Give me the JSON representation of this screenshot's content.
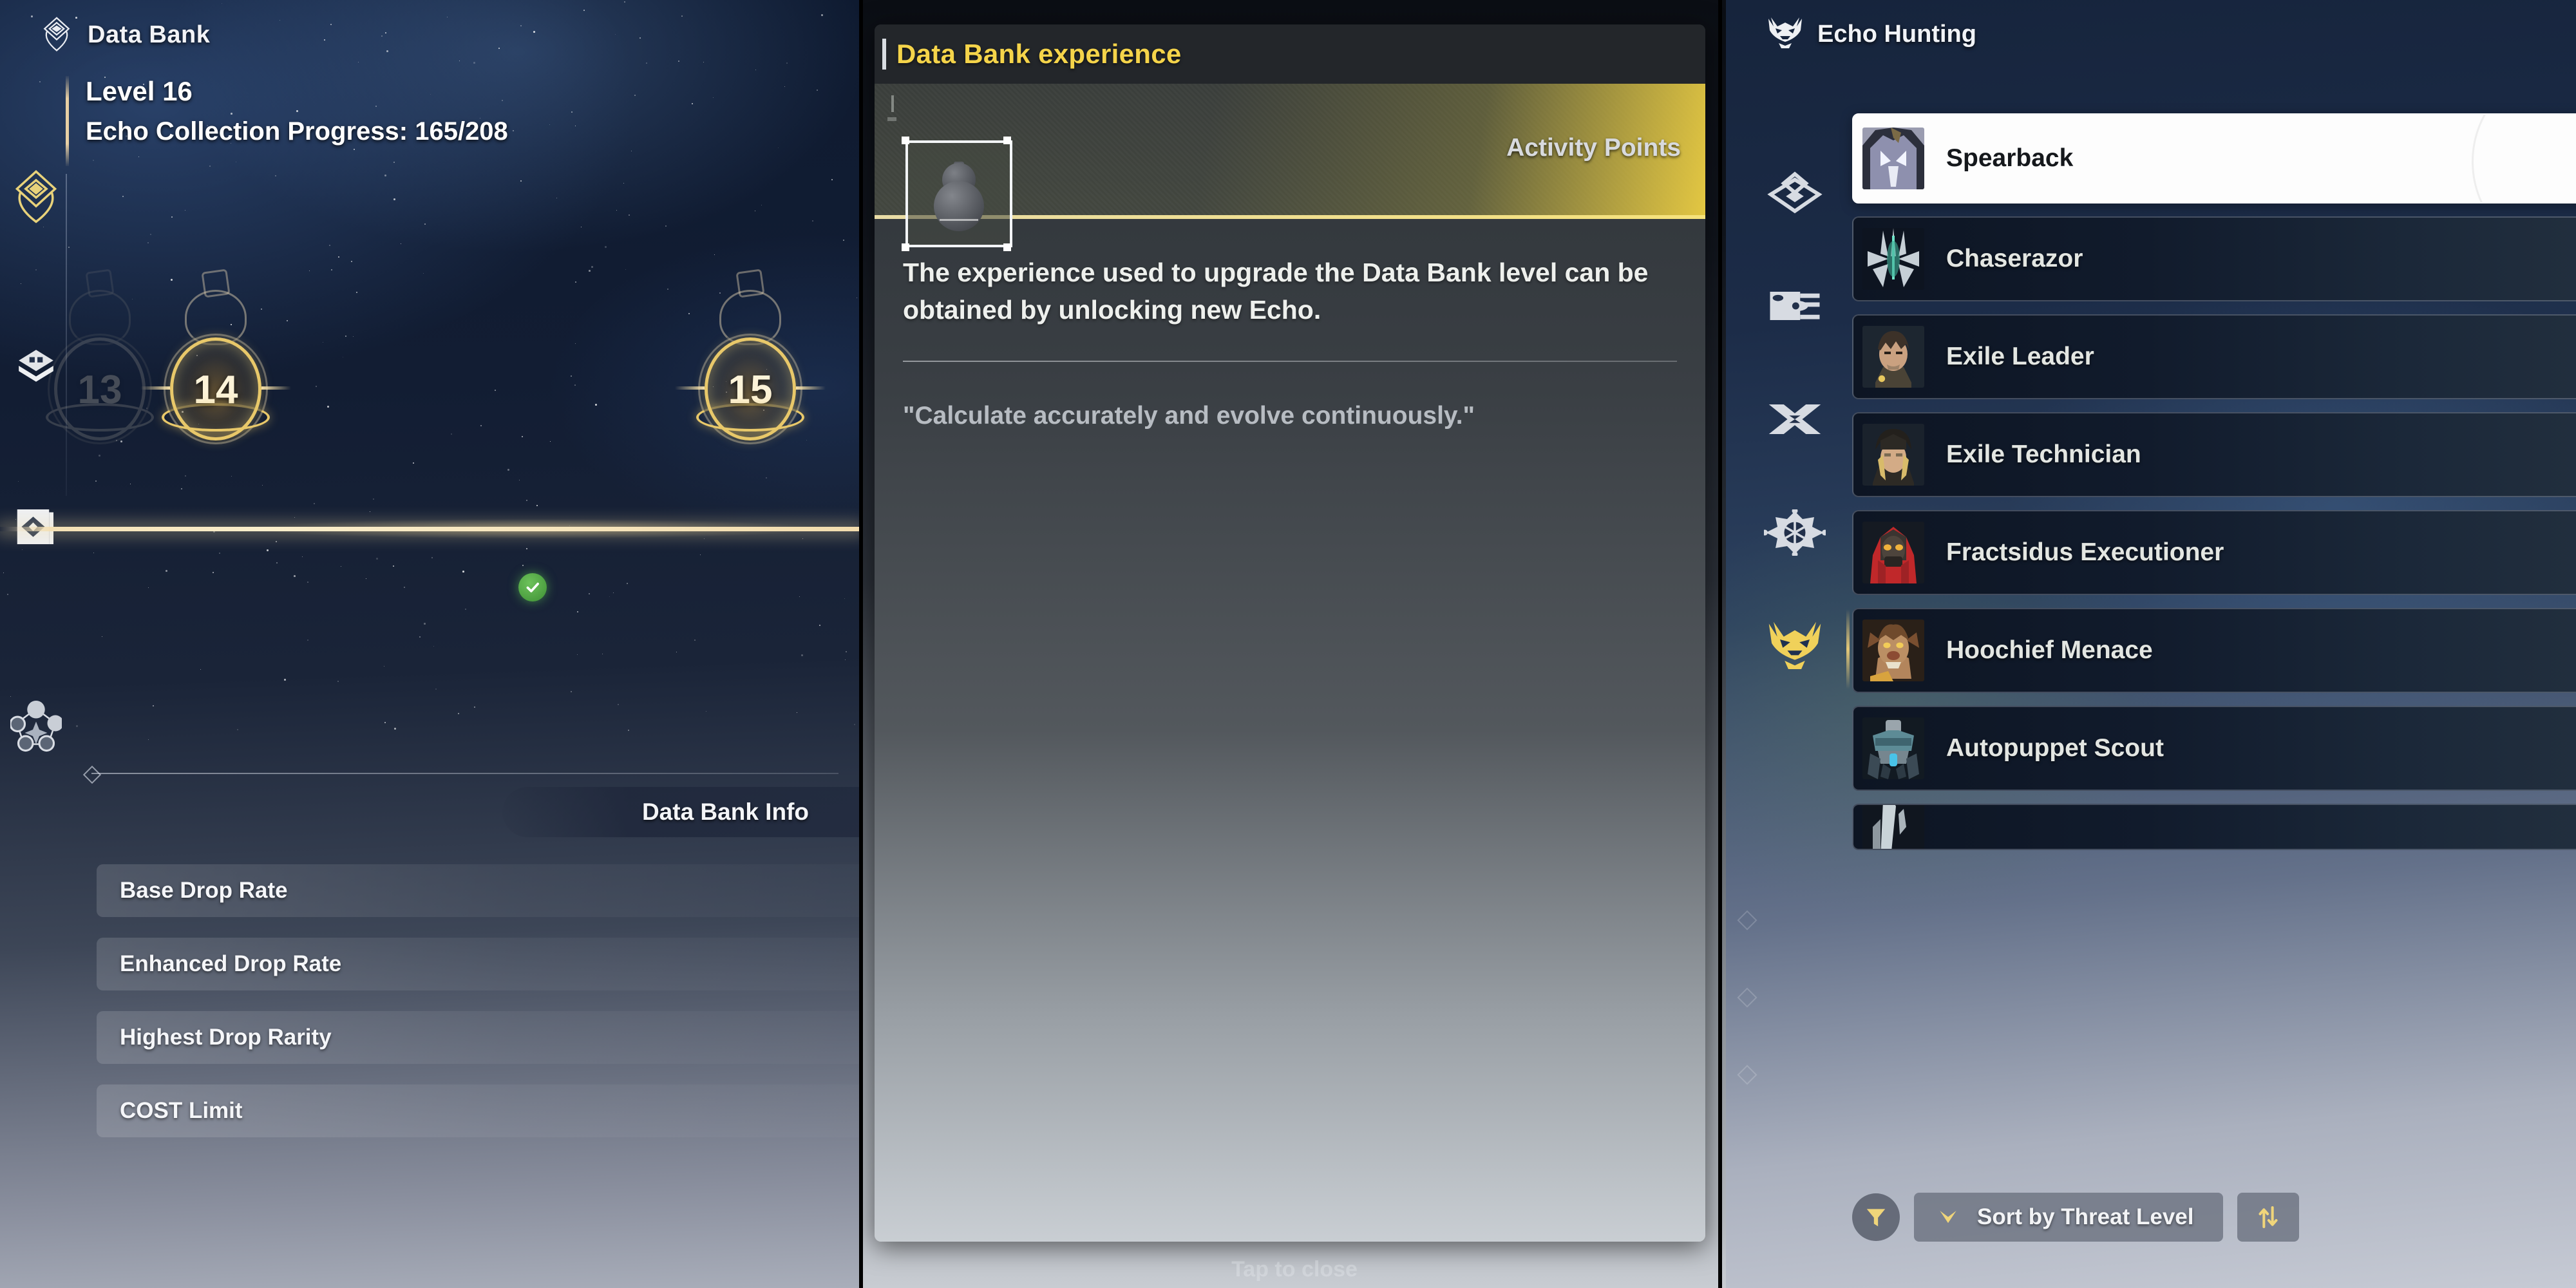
{
  "data_bank": {
    "title": "Data Bank",
    "title_icon": "data-bank-emblem-icon",
    "level_label": "Level 16",
    "progress_label": "Echo Collection Progress: 165/208",
    "rail_icons": [
      "data-bank-emblem-icon",
      "echo-emblem-icon",
      "echo-stack-icon",
      "echo-catalog-icon",
      "sonata-set-icon"
    ],
    "nodes": [
      {
        "number": "13",
        "state": "past"
      },
      {
        "number": "14",
        "state": "current"
      },
      {
        "number": "15",
        "state": "next"
      }
    ],
    "current_node_status_icon": "check-circle-icon",
    "info_tab_label": "Data Bank Info",
    "stats": [
      {
        "label": "Base Drop Rate"
      },
      {
        "label": "Enhanced Drop Rate"
      },
      {
        "label": "Highest Drop Rarity"
      },
      {
        "label": "COST Limit"
      }
    ]
  },
  "tooltip": {
    "title": "Data Bank experience",
    "title_color": "#f5d44a",
    "hero_label": "Activity Points",
    "item_icon": "gourd-item-icon",
    "description": "The experience used to upgrade the Data Bank level can be obtained by unlocking new Echo.",
    "flavor": "\"Calculate accurately and evolve continuously.\"",
    "footer_hint": "Tap to close"
  },
  "echo_hunting": {
    "title": "Echo Hunting",
    "title_icon": "beast-head-icon",
    "categories": [
      {
        "icon": "diamond-echo-icon",
        "active": false
      },
      {
        "icon": "card-echo-icon",
        "active": false
      },
      {
        "icon": "cross-echo-icon",
        "active": false
      },
      {
        "icon": "gear-star-echo-icon",
        "active": false
      },
      {
        "icon": "beast-head-icon",
        "active": true
      }
    ],
    "list": [
      {
        "name": "Spearback",
        "selected": true
      },
      {
        "name": "Chaserazor",
        "selected": false
      },
      {
        "name": "Exile Leader",
        "selected": false
      },
      {
        "name": "Exile Technician",
        "selected": false
      },
      {
        "name": "Fractsidus Executioner",
        "selected": false
      },
      {
        "name": "Hoochief Menace",
        "selected": false
      },
      {
        "name": "Autopuppet Scout",
        "selected": false
      },
      {
        "name": "",
        "selected": false
      }
    ],
    "toolbar": {
      "filter_icon": "funnel-icon",
      "sort_label": "Sort by Threat Level",
      "sort_chevron_icon": "chevron-down-icon",
      "order_icon": "sort-order-arrows-icon",
      "accent_color": "#f0d57a"
    }
  }
}
